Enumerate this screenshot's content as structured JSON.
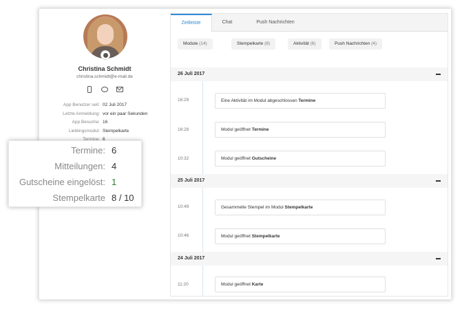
{
  "profile": {
    "name": "Christina Schmidt",
    "email": "christina.schmidt@e-mail.de",
    "stats": [
      {
        "label": "App Benutzer seit:",
        "value": "02 Juli 2017"
      },
      {
        "label": "Letzte Anmeldung:",
        "value": "vor ein paar Sekunden"
      },
      {
        "label": "App Besuche:",
        "value": "16"
      },
      {
        "label": "Lieblingsmodul:",
        "value": "Stempelkarte"
      },
      {
        "label": "Termine:",
        "value": "6"
      }
    ]
  },
  "callout": {
    "rows": [
      {
        "label": "Termine:",
        "value": "6"
      },
      {
        "label": "Mitteilungen:",
        "value": "4"
      },
      {
        "label": "Gutscheine eingelöst:",
        "value": "1"
      },
      {
        "label": "Stempelkarte",
        "value": "8 / 10"
      }
    ]
  },
  "tabs": [
    "Zeitleiste",
    "Chat",
    "Push Nachrichten"
  ],
  "filters": [
    {
      "label": "Module",
      "count": "(14)"
    },
    {
      "label": "Stempelkarte",
      "count": "(8)"
    },
    {
      "label": "Aktivität",
      "count": "(6)"
    },
    {
      "label": "Push Nachrichten",
      "count": "(4)"
    }
  ],
  "timeline": {
    "days": [
      {
        "date": "26 Juli 2017",
        "entries": [
          {
            "time": "16:29",
            "text": "Eine Aktivität im Modul abgeschlossen ",
            "bold": "Termine"
          },
          {
            "time": "16:28",
            "text": "Modul geöffnet ",
            "bold": "Termine"
          },
          {
            "time": "10:32",
            "text": "Modul geöffnet ",
            "bold": "Gutscheine"
          }
        ]
      },
      {
        "date": "25 Juli 2017",
        "entries": [
          {
            "time": "10:49",
            "text": "Gesammelte Stempel im Modul ",
            "bold": "Stempelkarte"
          },
          {
            "time": "10:46",
            "text": "Modul geöffnet ",
            "bold": "Stempelkarte"
          }
        ]
      },
      {
        "date": "24 Juli 2017",
        "entries": [
          {
            "time": "11:20",
            "text": "Modul geöffnet ",
            "bold": "Karte"
          }
        ]
      }
    ]
  },
  "icons": {
    "avatar_badge": "apple-icon",
    "contact": [
      "phone-icon",
      "chat-icon",
      "mail-icon"
    ],
    "collapse": "minus-icon"
  },
  "colors": {
    "accent": "#2f8bd6",
    "callout_green": "#2e7d32"
  }
}
